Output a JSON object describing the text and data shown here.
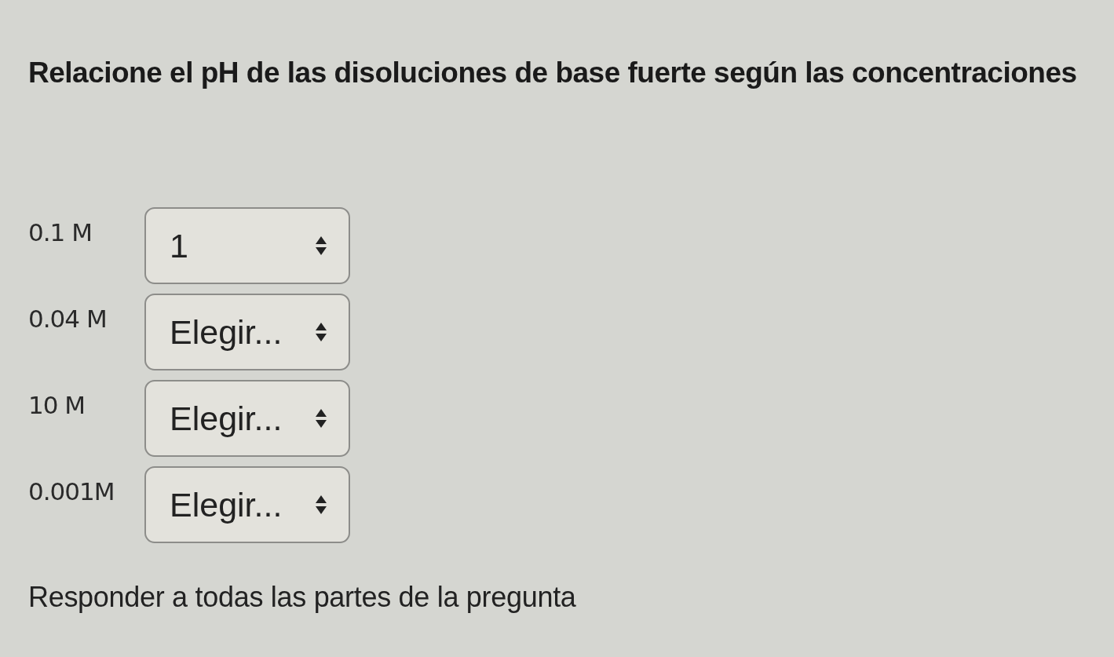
{
  "question": {
    "title": "Relacione el pH de las disoluciones de base fuerte según las concentraciones"
  },
  "rows": [
    {
      "label": "0.1 M",
      "value": "1"
    },
    {
      "label": "0.04 M",
      "value": "Elegir..."
    },
    {
      "label": "10 M",
      "value": "Elegir..."
    },
    {
      "label": "0.001M",
      "value": "Elegir..."
    }
  ],
  "footer": {
    "text": "Responder a todas las partes de la pregunta"
  }
}
